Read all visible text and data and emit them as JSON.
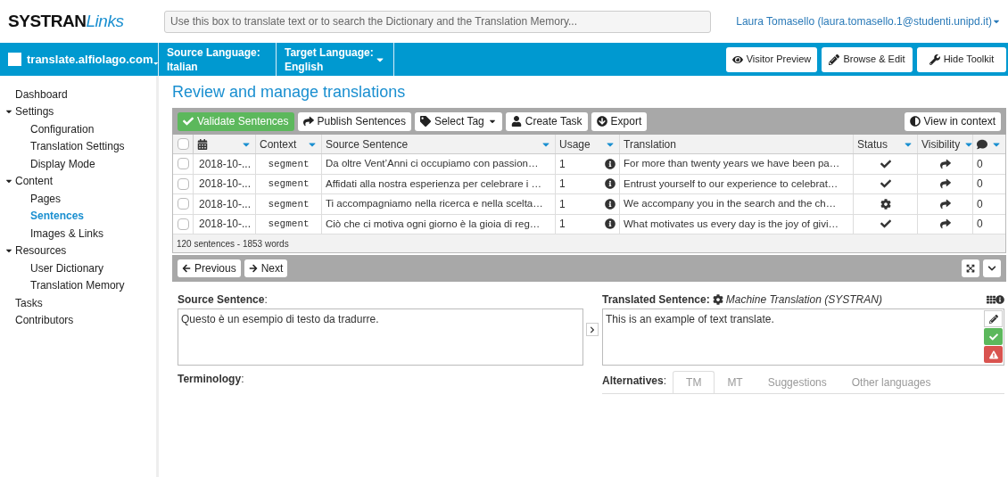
{
  "header": {
    "logo": {
      "brand": "SYSTRAN",
      "product": "Links"
    },
    "search": {
      "placeholder": "Use this box to translate text or to search the Dictionary and the Translation Memory..."
    },
    "user": "Laura Tomasello (laura.tomasello.1@studenti.unipd.it)"
  },
  "toolbar": {
    "site": "translate.alfiolago.com",
    "source_language": {
      "label": "Source Language:",
      "value": "Italian"
    },
    "target_language": {
      "label": "Target Language:",
      "value": "English"
    },
    "buttons": [
      {
        "kind": "eye",
        "label": "Visitor Preview"
      },
      {
        "kind": "pencil",
        "label": "Browse & Edit"
      },
      {
        "kind": "wrench",
        "label": "Hide Toolkit"
      }
    ]
  },
  "sidebar": {
    "items": [
      {
        "label": "Dashboard",
        "selected": false
      },
      {
        "label": "Settings",
        "selected": false,
        "expanded": true,
        "children": [
          {
            "label": "Configuration",
            "selected": false
          },
          {
            "label": "Translation Settings",
            "selected": false
          },
          {
            "label": "Display Mode",
            "selected": false
          }
        ]
      },
      {
        "label": "Content",
        "selected": false,
        "expanded": true,
        "children": [
          {
            "label": "Pages",
            "selected": false
          },
          {
            "label": "Sentences",
            "selected": true
          },
          {
            "label": "Images & Links",
            "selected": false
          }
        ]
      },
      {
        "label": "Resources",
        "selected": false,
        "expanded": true,
        "children": [
          {
            "label": "User Dictionary",
            "selected": false
          },
          {
            "label": "Translation Memory",
            "selected": false
          }
        ]
      },
      {
        "label": "Tasks",
        "selected": false
      },
      {
        "label": "Contributors",
        "selected": false
      }
    ]
  },
  "page_title": "Review and manage translations",
  "actions": [
    {
      "kind": "validate",
      "label": "Validate Sentences"
    },
    {
      "kind": "publish",
      "label": "Publish Sentences"
    },
    {
      "kind": "tag",
      "label": "Select Tag"
    },
    {
      "kind": "task",
      "label": "Create Task"
    },
    {
      "kind": "export",
      "label": "Export"
    }
  ],
  "view_in_context": "View in context",
  "table": {
    "header_checked": false,
    "columns": [
      {
        "kind": "date",
        "sortable": true
      },
      {
        "kind": "text",
        "label": "Context",
        "sortable": true
      },
      {
        "kind": "text",
        "label": "Source Sentence",
        "sortable": true
      },
      {
        "kind": "text",
        "label": "Usage",
        "sortable": true
      },
      {
        "kind": "text",
        "label": "Translation",
        "sortable": false
      },
      {
        "kind": "text",
        "label": "Status",
        "sortable": true
      },
      {
        "kind": "text",
        "label": "Visibility",
        "sortable": true
      },
      {
        "kind": "comments",
        "sortable": true
      }
    ],
    "rows": [
      {
        "checked": false,
        "date": "2018-10-...",
        "context": "segment",
        "source": "Da oltre Vent’Anni ci occupiamo con passion…",
        "usage": "1",
        "translation": "For more than twenty years we have been pa…",
        "status": {
          "kind": "validated"
        },
        "visibility": {
          "kind": "published"
        },
        "comments": "0"
      },
      {
        "checked": false,
        "date": "2018-10-...",
        "context": "segment",
        "source": "Affidati alla nostra esperienza per celebrare i …",
        "usage": "1",
        "translation": "Entrust yourself to our experience to celebrat…",
        "status": {
          "kind": "validated"
        },
        "visibility": {
          "kind": "published"
        },
        "comments": "0"
      },
      {
        "checked": false,
        "date": "2018-10-...",
        "context": "segment",
        "source": "Ti accompagniamo nella ricerca e nella scelta…",
        "usage": "1",
        "translation": "We accompany you in the search and the ch…",
        "status": {
          "kind": "machine"
        },
        "visibility": {
          "kind": "published"
        },
        "comments": "0"
      },
      {
        "checked": false,
        "date": "2018-10-...",
        "context": "segment",
        "source": "Ciò che ci motiva ogni giorno è la gioia di reg…",
        "usage": "1",
        "translation": "What motivates us every day is the joy of givi…",
        "status": {
          "kind": "validated"
        },
        "visibility": {
          "kind": "published"
        },
        "comments": "0"
      }
    ],
    "summary": "120 sentences - 1853 words"
  },
  "nav": {
    "previous": "Previous",
    "next": "Next"
  },
  "editor": {
    "source_label": "**Source Sentence**:",
    "source_text": "Questo è un esempio di testo da tradurre.",
    "translated_label": "Translated Sentence:",
    "translation_origin": "Machine Translation (SYSTRAN)",
    "translated_text": "This is an example of text translate.",
    "terminology_label": "**Terminology**:",
    "alternatives_label": "**Alternatives**:",
    "alternatives_tabs": [
      {
        "label": "TM",
        "selected": true
      },
      {
        "label": "MT",
        "selected": false
      },
      {
        "label": "Suggestions",
        "selected": false
      },
      {
        "label": "Other languages",
        "selected": false
      }
    ]
  }
}
